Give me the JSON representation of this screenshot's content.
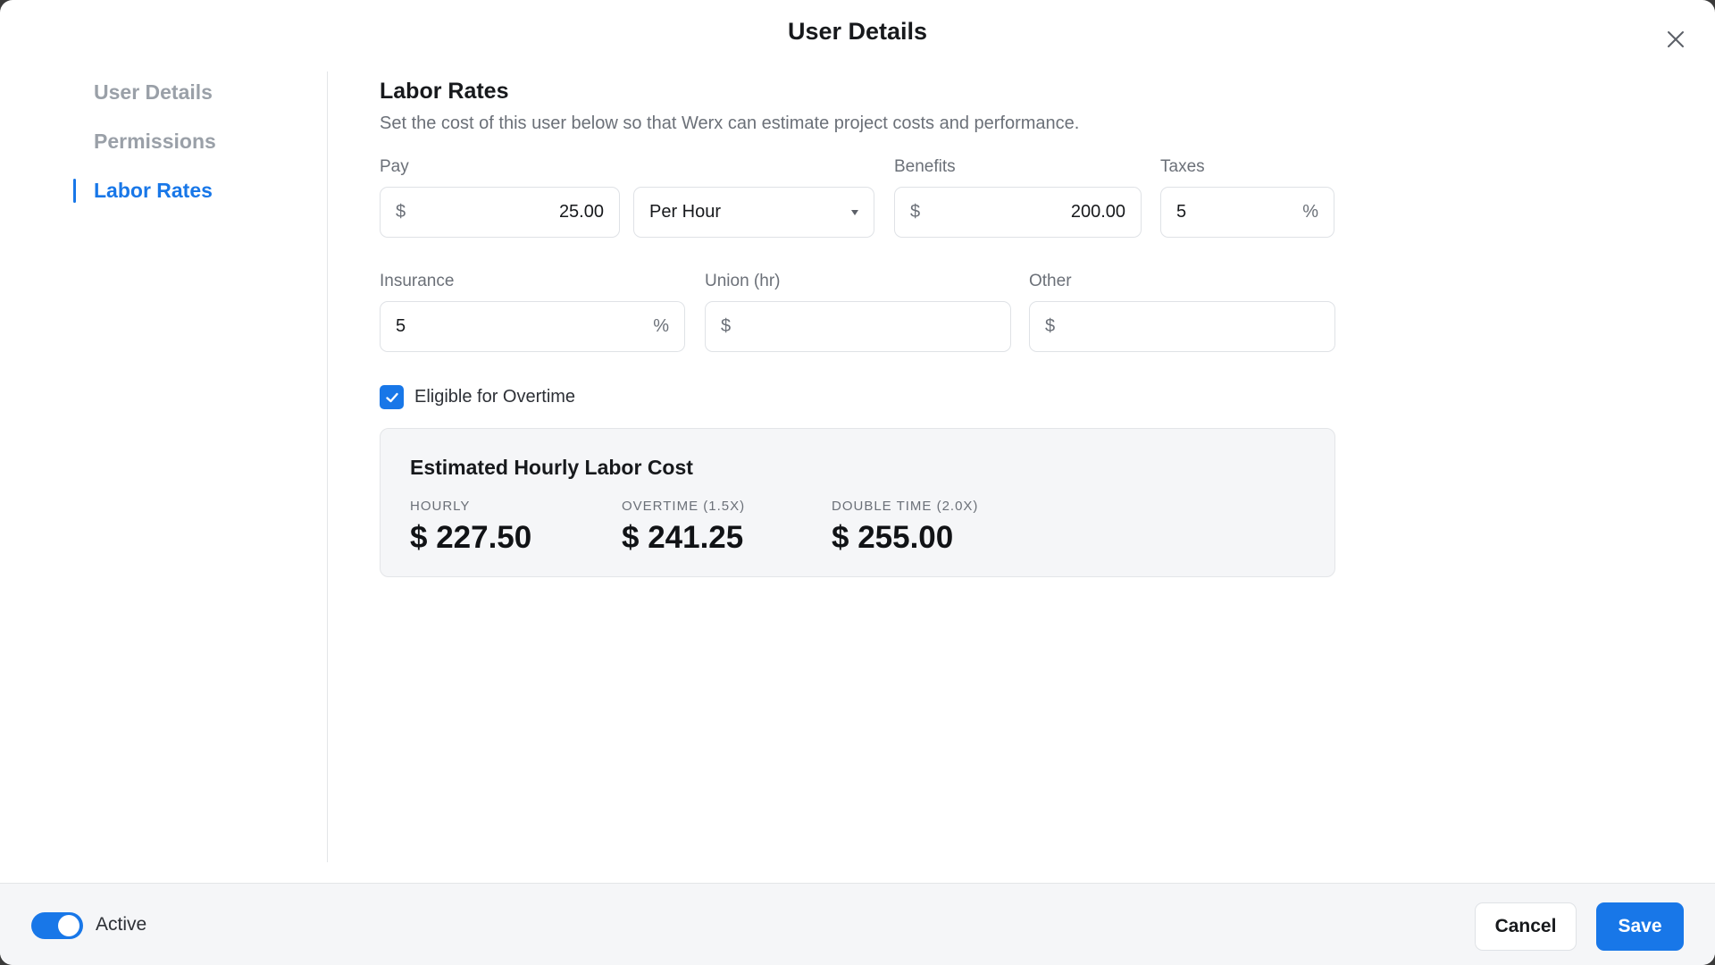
{
  "modal": {
    "title": "User Details"
  },
  "sidebar": {
    "items": [
      {
        "label": "User Details",
        "active": false
      },
      {
        "label": "Permissions",
        "active": false
      },
      {
        "label": "Labor Rates",
        "active": true
      }
    ]
  },
  "section": {
    "title": "Labor Rates",
    "description": "Set the cost of this user below so that Werx can estimate project costs and performance."
  },
  "fields": {
    "pay": {
      "label": "Pay",
      "prefix": "$",
      "value": "25.00"
    },
    "pay_period": {
      "value": "Per Hour"
    },
    "benefits": {
      "label": "Benefits",
      "prefix": "$",
      "value": "200.00"
    },
    "taxes": {
      "label": "Taxes",
      "value": "5",
      "suffix": "%"
    },
    "insurance": {
      "label": "Insurance",
      "value": "5",
      "suffix": "%"
    },
    "union": {
      "label": "Union (hr)",
      "prefix": "$",
      "value": ""
    },
    "other": {
      "label": "Other",
      "prefix": "$",
      "value": ""
    }
  },
  "overtime": {
    "label": "Eligible for Overtime",
    "checked": true
  },
  "estimate": {
    "title": "Estimated Hourly Labor Cost",
    "hourly": {
      "label": "HOURLY",
      "value": "$ 227.50"
    },
    "overtime": {
      "label": "OVERTIME (1.5X)",
      "value": "$ 241.25"
    },
    "double_time": {
      "label": "DOUBLE TIME (2.0X)",
      "value": "$ 255.00"
    }
  },
  "footer": {
    "active_label": "Active",
    "active_on": true,
    "cancel_label": "Cancel",
    "save_label": "Save"
  },
  "colors": {
    "accent": "#1877e8",
    "muted": "#9aa0a8"
  }
}
